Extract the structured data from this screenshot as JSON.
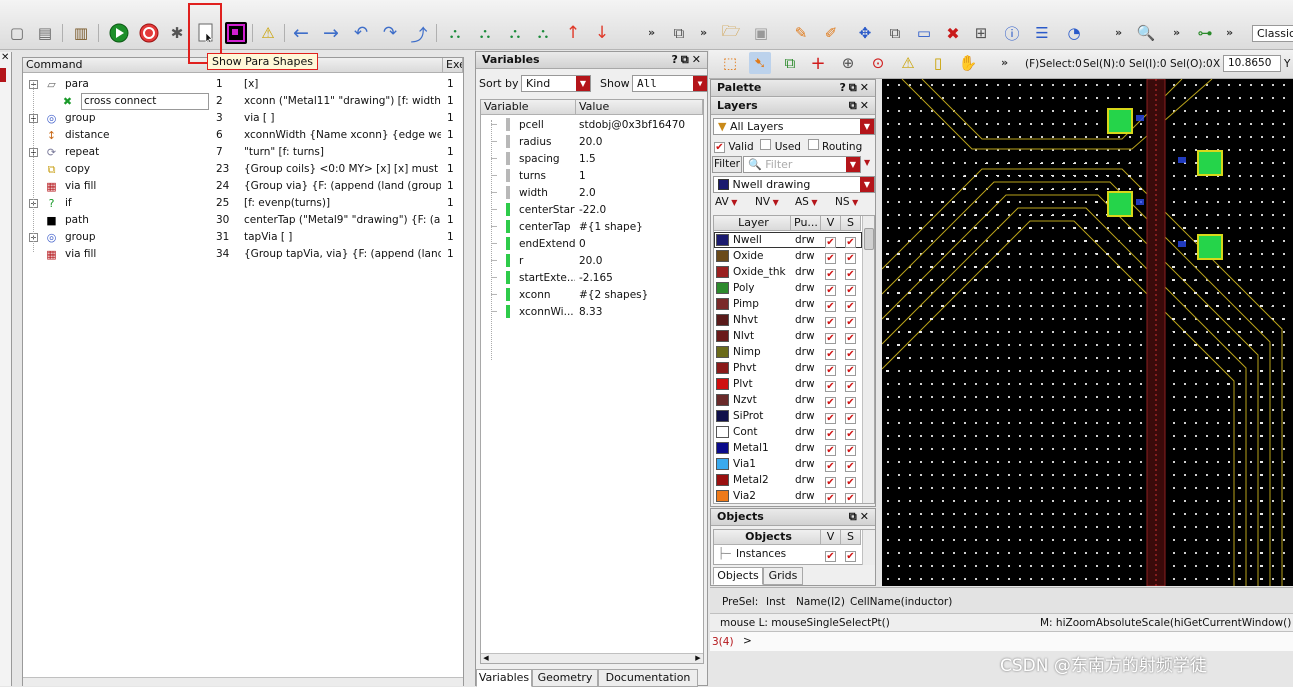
{
  "toolbar": {
    "tooltip": "Show Para Shapes",
    "more": "»",
    "select_status": "(F)Select:0",
    "sel_n": "Sel(N):0",
    "sel_i": "Sel(I):0",
    "sel_o": "Sel(O):0",
    "x_label": "X",
    "x_value": "10.8650",
    "y_label": "Y",
    "style_select": "Classic",
    "icons": [
      "new-icon",
      "paste-icon",
      "library-icon",
      "run-icon",
      "stop-icon",
      "debug-icon",
      "show-para-shapes-icon",
      "layout-icon",
      "warning-icon",
      "left-arrow-icon",
      "right-arrow-icon",
      "undo-icon",
      "redo-icon",
      "step-icon",
      "hierarchy-icon",
      "hierarchy-zoom-icon",
      "hierarchy-gear-icon",
      "hierarchy-alt-icon",
      "up-arrow-icon",
      "down-arrow-icon"
    ]
  },
  "command_panel": {
    "col_command": "Command",
    "col_exe": "Exe",
    "rows": [
      {
        "name": "para",
        "line": "1",
        "expr": "[x]",
        "exe": "1",
        "icon": "para-icon",
        "indent": 0,
        "expand": "-"
      },
      {
        "name": "cross connect",
        "line": "2",
        "expr": "xconn (\"Metal11\" \"drawing\") [f: width] ...",
        "exe": "1",
        "icon": "cross-connect-icon",
        "indent": 1,
        "expand": ""
      },
      {
        "name": "group",
        "line": "3",
        "expr": "via [ ]",
        "exe": "1",
        "icon": "group-icon",
        "indent": 0,
        "expand": "+"
      },
      {
        "name": "distance",
        "line": "6",
        "expr": "xconnWidth {Name xconn} {edge west...",
        "exe": "1",
        "icon": "distance-icon",
        "indent": 0,
        "expand": ""
      },
      {
        "name": "repeat",
        "line": "7",
        "expr": "\"turn\" [f: turns]",
        "exe": "1",
        "icon": "repeat-icon",
        "indent": 0,
        "expand": "+"
      },
      {
        "name": "copy",
        "line": "23",
        "expr": "{Group coils} <0:0 MY> [x] [x] must \"fr...",
        "exe": "1",
        "icon": "copy-icon",
        "indent": 0,
        "expand": ""
      },
      {
        "name": "via fill",
        "line": "24",
        "expr": "{Group via} {F: (append (land (group (\"...",
        "exe": "1",
        "icon": "via-fill-icon",
        "indent": 0,
        "expand": ""
      },
      {
        "name": "if",
        "line": "25",
        "expr": "[f: evenp(turns)]",
        "exe": "1",
        "icon": "if-icon",
        "indent": 0,
        "expand": "+"
      },
      {
        "name": "path",
        "line": "30",
        "expr": "centerTap (\"Metal9\" \"drawing\") {F: (app...",
        "exe": "1",
        "icon": "path-icon",
        "indent": 0,
        "expand": ""
      },
      {
        "name": "group",
        "line": "31",
        "expr": "tapVia [ ]",
        "exe": "1",
        "icon": "group-icon",
        "indent": 0,
        "expand": "+"
      },
      {
        "name": "via fill",
        "line": "34",
        "expr": "{Group tapVia, via} {F: (append (land (...",
        "exe": "1",
        "icon": "via-fill-icon",
        "indent": 0,
        "expand": ""
      }
    ]
  },
  "variables_panel": {
    "title": "Variables",
    "sort_by_label": "Sort by",
    "sort_by_value": "Kind",
    "show_label": "Show",
    "show_value": "All",
    "col_variable": "Variable",
    "col_value": "Value",
    "rows": [
      {
        "name": "pcell",
        "value": "stdobj@0x3bf16470",
        "kind": "grey"
      },
      {
        "name": "radius",
        "value": "20.0",
        "kind": "grey"
      },
      {
        "name": "spacing",
        "value": "1.5",
        "kind": "grey"
      },
      {
        "name": "turns",
        "value": "1",
        "kind": "grey"
      },
      {
        "name": "width",
        "value": "2.0",
        "kind": "grey"
      },
      {
        "name": "centerStart",
        "value": "-22.0",
        "kind": "green"
      },
      {
        "name": "centerTap",
        "value": "#{1 shape}",
        "kind": "green"
      },
      {
        "name": "endExtend",
        "value": "0",
        "kind": "green"
      },
      {
        "name": "r",
        "value": "20.0",
        "kind": "green"
      },
      {
        "name": "startExte...",
        "value": "-2.165",
        "kind": "green"
      },
      {
        "name": "xconn",
        "value": "#{2 shapes}",
        "kind": "green"
      },
      {
        "name": "xconnWi...",
        "value": "8.33",
        "kind": "green"
      }
    ],
    "tabs": [
      "Variables",
      "Geometry",
      "Documentation"
    ]
  },
  "palette": {
    "title": "Palette",
    "layers_title": "Layers",
    "layer_filter": "All Layers",
    "valid_label": "Valid",
    "used_label": "Used",
    "routing_label": "Routing",
    "filter_button": "Filter",
    "filter_placeholder": "Filter",
    "current_layer": "Nwell drawing",
    "vis_buttons": [
      "AV",
      "NV",
      "AS",
      "NS"
    ],
    "col_layer": "Layer",
    "col_purpose": "Pu...",
    "col_v": "V",
    "col_s": "S",
    "layers": [
      {
        "name": "Nwell",
        "purpose": "drw",
        "color": "#1a1a6e"
      },
      {
        "name": "Oxide",
        "purpose": "drw",
        "color": "#6a4a1a"
      },
      {
        "name": "Oxide_thk",
        "purpose": "drw",
        "color": "#9a2020"
      },
      {
        "name": "Poly",
        "purpose": "drw",
        "color": "#2d8a2d"
      },
      {
        "name": "Pimp",
        "purpose": "drw",
        "color": "#7a2a2a"
      },
      {
        "name": "Nhvt",
        "purpose": "drw",
        "color": "#5a1a1a"
      },
      {
        "name": "Nlvt",
        "purpose": "drw",
        "color": "#6a1a1a"
      },
      {
        "name": "Nimp",
        "purpose": "drw",
        "color": "#6a6a1a"
      },
      {
        "name": "Phvt",
        "purpose": "drw",
        "color": "#8a1a1a"
      },
      {
        "name": "Plvt",
        "purpose": "drw",
        "color": "#d01010"
      },
      {
        "name": "Nzvt",
        "purpose": "drw",
        "color": "#6a2a2a"
      },
      {
        "name": "SiProt",
        "purpose": "drw",
        "color": "#10104a"
      },
      {
        "name": "Cont",
        "purpose": "drw",
        "color": "#ffffff"
      },
      {
        "name": "Metal1",
        "purpose": "drw",
        "color": "#0a0a8a"
      },
      {
        "name": "Via1",
        "purpose": "drw",
        "color": "#3aaaee"
      },
      {
        "name": "Metal2",
        "purpose": "drw",
        "color": "#9a1010"
      },
      {
        "name": "Via2",
        "purpose": "drw",
        "color": "#ee7a1a"
      }
    ],
    "objects_title": "Objects",
    "objects_col": "Objects",
    "objects_v": "V",
    "objects_s": "S",
    "instances_label": "Instances",
    "tabs": [
      "Objects",
      "Grids"
    ]
  },
  "statusbar": {
    "presel": "PreSel:",
    "inst": "Inst",
    "name": "Name(I2)",
    "cellname": "CellName(inductor)",
    "mouse_l": "mouse L: mouseSingleSelectPt()",
    "mouse_m": "M: hiZoomAbsoluteScale(hiGetCurrentWindow() 0.9)",
    "cmd_count": "3(4)",
    "prompt": ">",
    "watermark": "CSDN @东南方的射频学徒"
  }
}
